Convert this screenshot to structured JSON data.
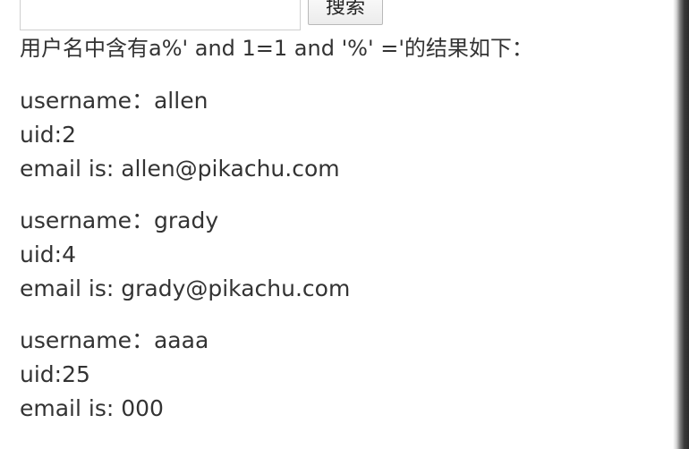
{
  "search": {
    "input_value": "",
    "button_label": "搜索"
  },
  "summary_text": "用户名中含有a%' and 1=1 and '%' ='的结果如下：",
  "results": [
    {
      "username_line": "username：allen",
      "uid_line": "uid:2",
      "email_line": "email is: allen@pikachu.com"
    },
    {
      "username_line": "username：grady",
      "uid_line": "uid:4",
      "email_line": "email is: grady@pikachu.com"
    },
    {
      "username_line": "username：aaaa",
      "uid_line": "uid:25",
      "email_line": "email is: 000"
    }
  ]
}
